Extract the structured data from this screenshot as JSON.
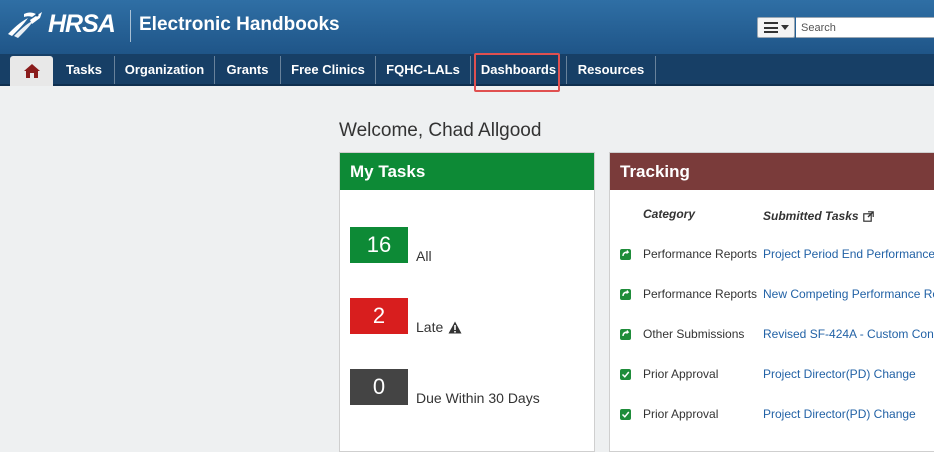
{
  "header": {
    "logo_text": "HRSA",
    "app_title": "Electronic Handbooks",
    "search": {
      "placeholder": "Search",
      "value": ""
    }
  },
  "nav": {
    "items": [
      {
        "label": "Tasks"
      },
      {
        "label": "Organization"
      },
      {
        "label": "Grants"
      },
      {
        "label": "Free Clinics"
      },
      {
        "label": "FQHC-LALs"
      },
      {
        "label": "Dashboards",
        "highlighted": true
      },
      {
        "label": "Resources"
      }
    ]
  },
  "welcome": "Welcome, Chad Allgood",
  "my_tasks": {
    "title": "My Tasks",
    "rows": [
      {
        "count": "16",
        "label": "All",
        "color": "#0d8a36"
      },
      {
        "count": "2",
        "label": "Late",
        "color": "#d81e1e"
      },
      {
        "count": "0",
        "label": "Due Within 30 Days",
        "color": "#444444"
      }
    ]
  },
  "tracking": {
    "title": "Tracking",
    "col_category": "Category",
    "col_submitted": "Submitted Tasks",
    "rows": [
      {
        "icon": "refresh-icon",
        "category": "Performance Reports",
        "task": "Project Period End Performance"
      },
      {
        "icon": "refresh-icon",
        "category": "Performance Reports",
        "task": "New Competing Performance Re"
      },
      {
        "icon": "refresh-icon",
        "category": "Other Submissions",
        "task": "Revised SF-424A - Custom Con"
      },
      {
        "icon": "check-icon",
        "category": "Prior Approval",
        "task": "Project Director(PD) Change"
      },
      {
        "icon": "check-icon",
        "category": "Prior Approval",
        "task": "Project Director(PD) Change"
      }
    ]
  },
  "colors": {
    "header": "#1f5588",
    "nav": "#173f66",
    "tasks_header": "#0d8a36",
    "tracking_header": "#7a3b3a",
    "highlight": "#e05050",
    "link": "#2262a6"
  }
}
